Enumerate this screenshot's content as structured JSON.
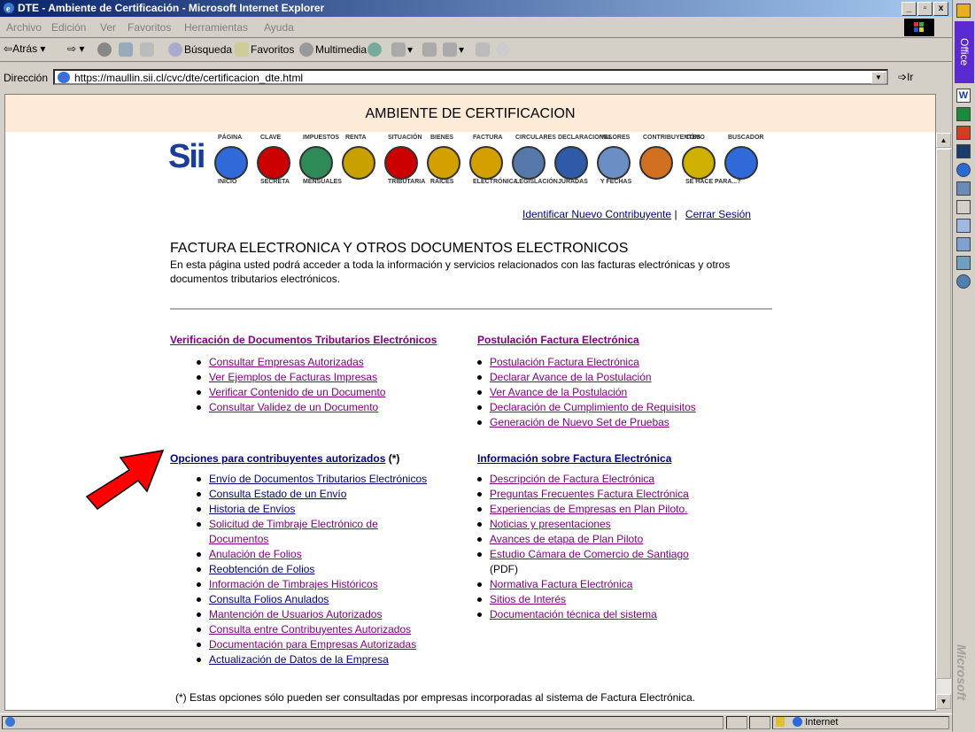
{
  "window": {
    "title": "DTE - Ambiente de Certificación - Microsoft Internet Explorer",
    "controls": [
      "_",
      "▫",
      "x"
    ]
  },
  "menu": [
    "Archivo",
    "Edición",
    "Ver",
    "Favoritos",
    "Herramientas",
    "Ayuda"
  ],
  "toolbar": {
    "back": "Atrás",
    "search": "Búsqueda",
    "favorites": "Favoritos",
    "multimedia": "Multimedia"
  },
  "address": {
    "label": "Dirección",
    "url": "https://maullin.sii.cl/cvc/dte/certificacion_dte.html",
    "go": "Ir"
  },
  "banner": {
    "title": "AMBIENTE DE CERTIFICACION"
  },
  "header_icons": {
    "logo_text": "Sii",
    "labels": [
      "PÁGINA INICIO",
      "CLAVE SECRETA",
      "IMPUESTOS MENSUALES",
      "RENTA",
      "SITUACIÓN TRIBUTARIA",
      "BIENES RAÍCES",
      "FACTURA ELECTRÓNICA",
      "CIRCULARES LEGISLACIÓN",
      "DECLARACIONES JURADAS",
      "VALORES Y FECHAS",
      "CONTRIBUYENTES",
      "CÓMO SE HACE PARA...?",
      "BUSCADOR"
    ],
    "colors": [
      "#2f6ad8",
      "#cc0000",
      "#2e8b57",
      "#c8a000",
      "#cc0000",
      "#d4a000",
      "#d4a000",
      "#5577aa",
      "#2f5aa8",
      "#6b8fc4",
      "#d07020",
      "#d0b000",
      "#2f6ad8"
    ]
  },
  "session": {
    "identify": "Identificar Nuevo Contribuyente",
    "sep": "|",
    "logout": "Cerrar Sesión"
  },
  "page": {
    "title": "FACTURA ELECTRONICA Y OTROS DOCUMENTOS ELECTRONICOS",
    "intro": "En esta página usted podrá acceder a toda la información y servicios relacionados con las facturas electrónicas y otros documentos tributarios electrónicos."
  },
  "sections": {
    "verificacion": {
      "title": "Verificación de Documentos Tributarios Electrónicos",
      "items": [
        "Consultar Empresas Autorizadas",
        "Ver Ejemplos de Facturas Impresas",
        "Verificar Contenido de un Documento",
        "Consultar Validez de un Documento"
      ]
    },
    "postulacion": {
      "title": "Postulación Factura Electrónica",
      "items": [
        "Postulación Factura Electrónica",
        "Declarar Avance de la Postulación",
        "Ver Avance de la Postulación",
        "Declaración de Cumplimiento de Requisitos",
        "Generación de Nuevo Set de Pruebas"
      ]
    },
    "opciones": {
      "title": "Opciones para contribuyentes autorizados",
      "note": "(*)",
      "items": [
        "Envío de Documentos Tributarios Electrónicos",
        "Consulta Estado de un Envío",
        "Historia de Envíos",
        "Solicitud de Timbraje Electrónico de Documentos",
        "Anulación de Folios",
        "Reobtención de Folios",
        "Información de Timbrajes Históricos",
        "Consulta Folios Anulados",
        "Mantención de Usuarios Autorizados",
        "Consulta entre Contribuyentes Autorizados",
        "Documentación para Empresas Autorizadas",
        "Actualización de Datos de la Empresa"
      ]
    },
    "informacion": {
      "title": "Información sobre Factura Electrónica",
      "items": [
        "Descripción de Factura Electrónica",
        "Preguntas Frecuentes Factura Electrónica",
        "Experiencias de Empresas en Plan Piloto.",
        "Noticias y presentaciones",
        "Avances de etapa de Plan Piloto",
        "Estudio Cámara de Comercio de Santiago",
        "Normativa Factura Electrónica",
        "Sitios de Interés",
        "Documentación técnica del sistema"
      ],
      "pdf_note": "(PDF)"
    }
  },
  "footnote": "(*) Estas opciones sólo pueden ser consultadas por empresas incorporadas al sistema de Factura Electrónica.",
  "status": {
    "zone": "Internet"
  },
  "officebar": {
    "title": "Office",
    "brand": "Microsoft"
  },
  "colors": {
    "banner": "#fdebd8",
    "link": "#000080",
    "visited": "#800080",
    "arrow": "#ff0000"
  }
}
